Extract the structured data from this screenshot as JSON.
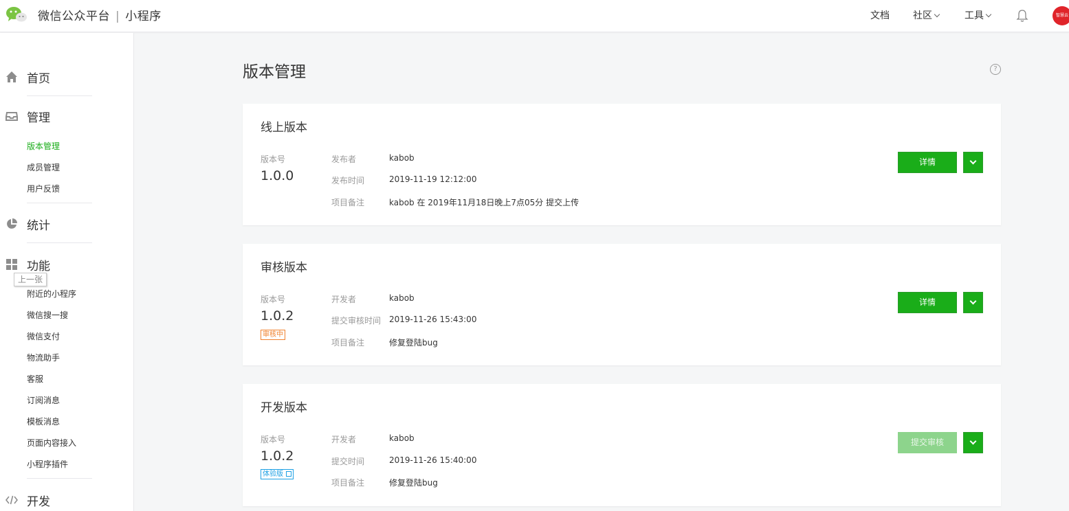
{
  "topbar": {
    "brand": "微信公众平台",
    "separator": "|",
    "product": "小程序",
    "nav": {
      "docs": "文档",
      "community": "社区",
      "tools": "工具"
    },
    "avatar_text": "智慧云"
  },
  "sidebar": {
    "home": "首页",
    "manage": "管理",
    "manage_items": [
      "版本管理",
      "成员管理",
      "用户反馈"
    ],
    "stats": "统计",
    "features": "功能",
    "tooltip": "上一张",
    "feature_items": [
      "附近的小程序",
      "微信搜一搜",
      "微信支付",
      "物流助手",
      "客服",
      "订阅消息",
      "模板消息",
      "页面内容接入",
      "小程序插件"
    ],
    "dev": "开发"
  },
  "main": {
    "title": "版本管理",
    "help": "?"
  },
  "cards": {
    "online": {
      "title": "线上版本",
      "version_label": "版本号",
      "version": "1.0.0",
      "rows": [
        {
          "k": "发布者",
          "v": "kabob"
        },
        {
          "k": "发布时间",
          "v": "2019-11-19 12:12:00"
        },
        {
          "k": "项目备注",
          "v": "kabob 在 2019年11月18日晚上7点05分 提交上传"
        }
      ],
      "button": "详情"
    },
    "review": {
      "title": "审核版本",
      "version_label": "版本号",
      "version": "1.0.2",
      "tag": "审核中",
      "rows": [
        {
          "k": "开发者",
          "v": "kabob"
        },
        {
          "k": "提交审核时间",
          "v": "2019-11-26 15:43:00"
        },
        {
          "k": "项目备注",
          "v": "修复登陆bug"
        }
      ],
      "button": "详情"
    },
    "dev": {
      "title": "开发版本",
      "version_label": "版本号",
      "version": "1.0.2",
      "tag": "体验版",
      "rows": [
        {
          "k": "开发者",
          "v": "kabob"
        },
        {
          "k": "提交时间",
          "v": "2019-11-26 15:40:00"
        },
        {
          "k": "项目备注",
          "v": "修复登陆bug"
        }
      ],
      "button": "提交审核"
    }
  },
  "colors": {
    "accent": "#1aad19",
    "review_tag": "#f0812d",
    "trial_tag": "#1da0e4",
    "avatar": "#e0242a"
  }
}
